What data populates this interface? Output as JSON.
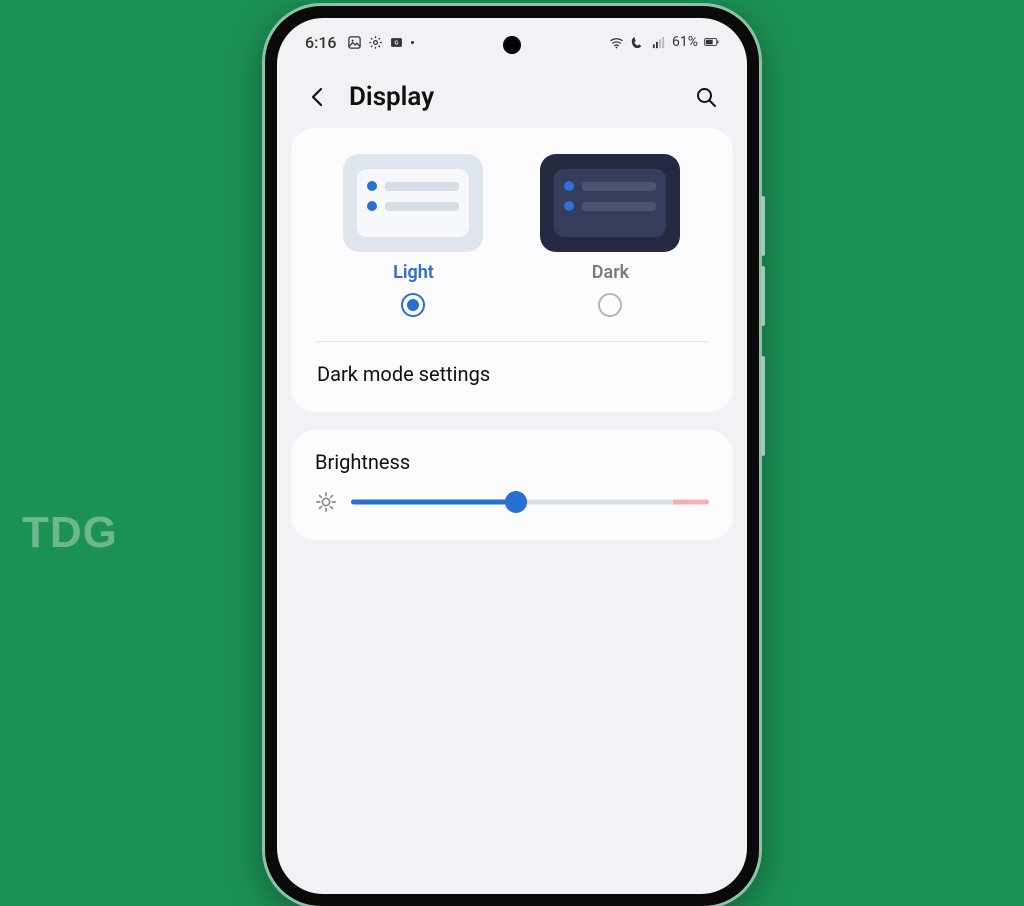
{
  "watermark": "TDG",
  "statusbar": {
    "time": "6:16",
    "battery_percent": "61%"
  },
  "titlebar": {
    "title": "Display"
  },
  "theme": {
    "light_label": "Light",
    "dark_label": "Dark",
    "selected": "light"
  },
  "rows": {
    "dark_mode_settings": "Dark mode settings"
  },
  "brightness": {
    "title": "Brightness",
    "value_pct": 46
  }
}
